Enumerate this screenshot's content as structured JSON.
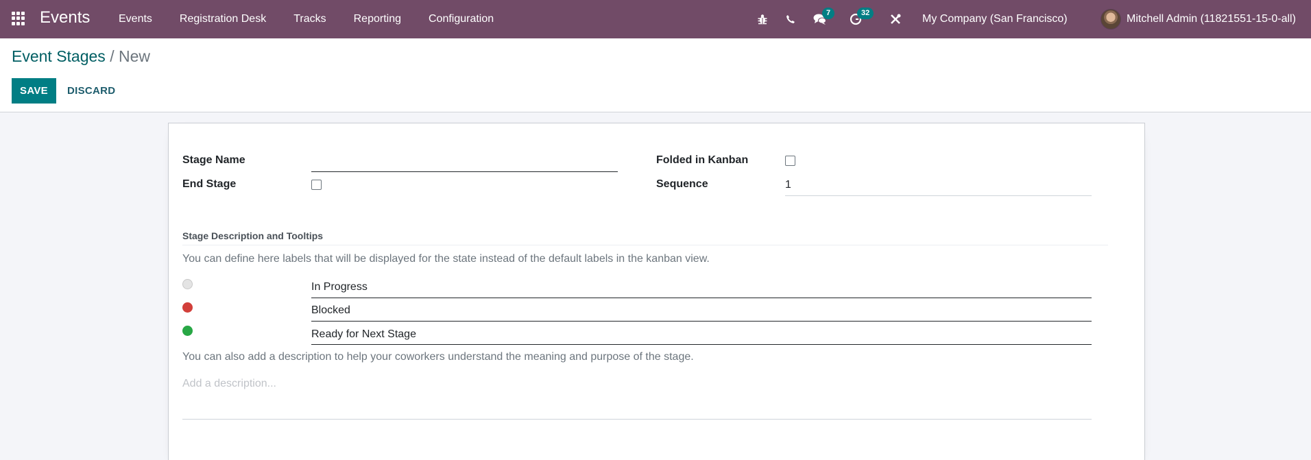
{
  "navbar": {
    "app_name": "Events",
    "menu": [
      {
        "label": "Events"
      },
      {
        "label": "Registration Desk"
      },
      {
        "label": "Tracks"
      },
      {
        "label": "Reporting"
      },
      {
        "label": "Configuration"
      }
    ],
    "systray": {
      "bug_icon": "bug-icon",
      "phone_icon": "phone-icon",
      "messages_icon": "chat-icon",
      "messages_count": "7",
      "activities_icon": "clock-icon",
      "activities_count": "32",
      "settings_icon": "tools-icon"
    },
    "company": "My Company (San Francisco)",
    "user": "Mitchell Admin (11821551-15-0-all)"
  },
  "control_panel": {
    "breadcrumb": [
      {
        "label": "Event Stages"
      },
      {
        "label": "New"
      }
    ],
    "breadcrumb_separator": "/",
    "save_label": "SAVE",
    "discard_label": "DISCARD"
  },
  "form": {
    "stage_name": {
      "label": "Stage Name",
      "value": ""
    },
    "end_stage": {
      "label": "End Stage",
      "checked": false
    },
    "folded_in_kanban": {
      "label": "Folded in Kanban",
      "checked": false
    },
    "sequence": {
      "label": "Sequence",
      "value": "1"
    },
    "section_title": "Stage Description and Tooltips",
    "labels_help": "You can define here labels that will be displayed for the state instead of the default labels in the kanban view.",
    "states": [
      {
        "color": "#e4e4e4",
        "name": "grey-state",
        "value": "In Progress"
      },
      {
        "color": "#d23f3a",
        "name": "red-state",
        "value": "Blocked"
      },
      {
        "color": "#28a745",
        "name": "green-state",
        "value": "Ready for Next Stage"
      }
    ],
    "description_help": "You can also add a description to help your coworkers understand the meaning and purpose of the stage.",
    "description_placeholder": "Add a description...",
    "description_value": ""
  },
  "colors": {
    "navbar": "#714b67",
    "primary": "#017e84"
  }
}
